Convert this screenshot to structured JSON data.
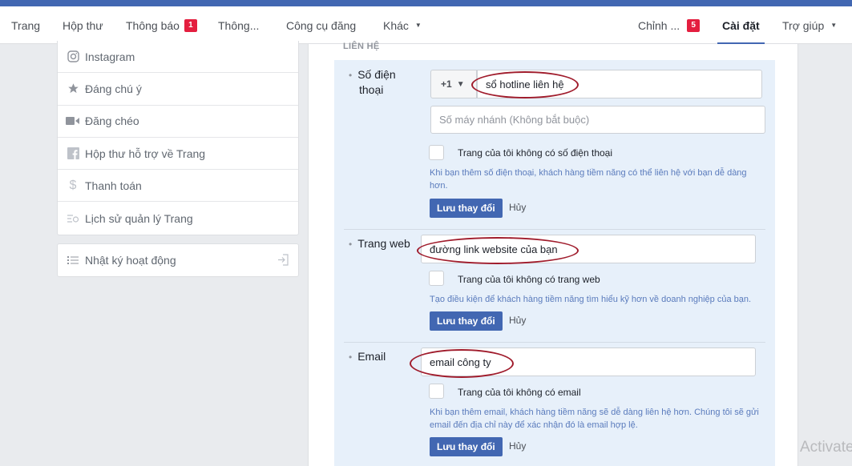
{
  "nav": {
    "left": [
      {
        "label": "Trang"
      },
      {
        "label": "Hộp thư"
      },
      {
        "label": "Thông báo",
        "badge": "1"
      },
      {
        "label": "Thông..."
      },
      {
        "label": "Công cụ đăng"
      },
      {
        "label": "Khác",
        "caret": "▼"
      }
    ],
    "right": [
      {
        "label": "Chỉnh ...",
        "badge": "5"
      },
      {
        "label": "Cài đặt",
        "active": true
      },
      {
        "label": "Trợ giúp",
        "caret": "▼"
      }
    ]
  },
  "sidebar": {
    "items": [
      {
        "label": "Instagram",
        "icon": "instagram-icon"
      },
      {
        "label": "Đáng chú ý",
        "icon": "star-icon"
      },
      {
        "label": "Đăng chéo",
        "icon": "video-camera-icon"
      },
      {
        "label": "Hộp thư hỗ trợ về Trang",
        "icon": "facebook-icon"
      },
      {
        "label": "Thanh toán",
        "icon": "dollar-icon"
      },
      {
        "label": "Lịch sử quản lý Trang",
        "icon": "history-icon"
      }
    ],
    "activity_log": {
      "label": "Nhật ký hoạt động",
      "icon": "list-icon",
      "action_icon": "exit-icon"
    }
  },
  "main": {
    "section_label": "LIÊN HỆ",
    "phone": {
      "label_line1": "Số điện",
      "label_line2": "thoại",
      "country_code": "+1",
      "value": "sổ hotline liên hệ",
      "extension_placeholder": "Số máy nhánh (Không bắt buộc)",
      "checkbox_label": "Trang của tôi không có số điện thoại",
      "hint_line1": "Khi bạn thêm số điện thoại, khách hàng tiềm năng có thể liên hệ với bạn dễ dàng",
      "hint_line2": "hơn.",
      "save": "Lưu thay đổi",
      "cancel": "Hủy"
    },
    "website": {
      "label": "Trang web",
      "value": "đường link website của bạn",
      "checkbox_label": "Trang của tôi không có trang web",
      "hint": "Tạo điều kiện để khách hàng tiềm năng tìm hiểu kỹ hơn về doanh nghiệp của bạn.",
      "save": "Lưu thay đổi",
      "cancel": "Hủy"
    },
    "email": {
      "label": "Email",
      "value": "email công ty",
      "checkbox_label": "Trang của tôi không có email",
      "hint_line1": "Khi bạn thêm email, khách hàng tiềm năng sẽ dễ dàng liên hệ hơn. Chúng tôi sẽ gửi",
      "hint_line2": "email đến địa chỉ này để xác nhận đó là email hợp lệ.",
      "save": "Lưu thay đổi",
      "cancel": "Hủy"
    }
  },
  "watermark": "Activate"
}
